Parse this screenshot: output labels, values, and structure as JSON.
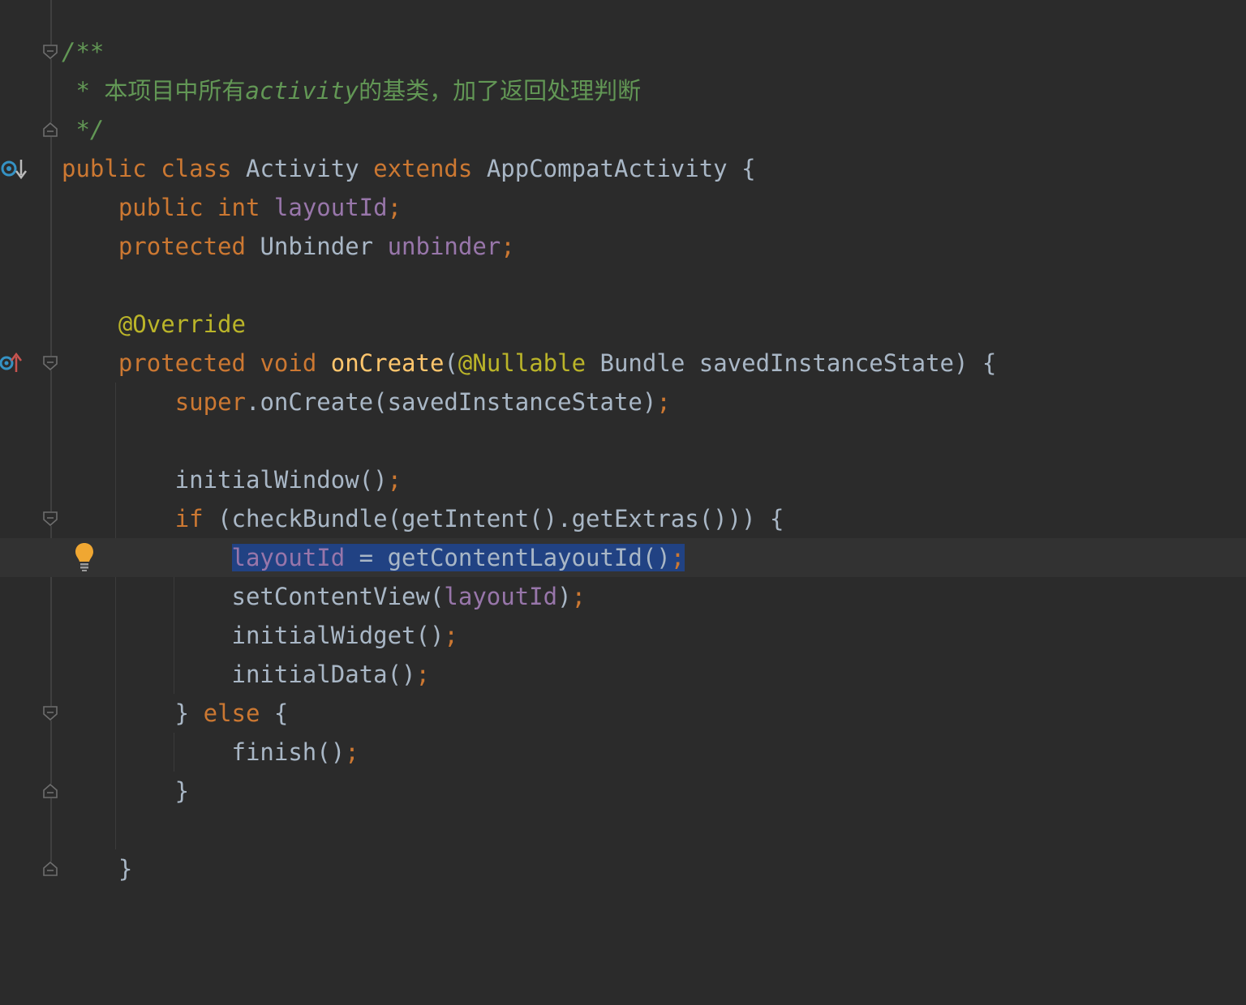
{
  "editor": {
    "lines": [
      {
        "t": "/**",
        "k": "doc"
      },
      {
        "t": " * 本项目中所有activity的基类，加了返回处理判断",
        "k": "doc"
      },
      {
        "t": " */",
        "k": "doc"
      },
      {
        "t": "public class Activity extends AppCompatActivity {",
        "k": "code"
      },
      {
        "t": "    public int layoutId;",
        "k": "code"
      },
      {
        "t": "    protected Unbinder unbinder;",
        "k": "code"
      },
      {
        "t": "",
        "k": "blank"
      },
      {
        "t": "    @Override",
        "k": "code"
      },
      {
        "t": "    protected void onCreate(@Nullable Bundle savedInstanceState) {",
        "k": "code"
      },
      {
        "t": "        super.onCreate(savedInstanceState);",
        "k": "code"
      },
      {
        "t": "",
        "k": "blank"
      },
      {
        "t": "        initialWindow();",
        "k": "code"
      },
      {
        "t": "        if (checkBundle(getIntent().getExtras())) {",
        "k": "code"
      },
      {
        "t": "            layoutId = getContentLayoutId();",
        "k": "code"
      },
      {
        "t": "            setContentView(layoutId);",
        "k": "code"
      },
      {
        "t": "            initialWidget();",
        "k": "code"
      },
      {
        "t": "            initialData();",
        "k": "code"
      },
      {
        "t": "        } else {",
        "k": "code"
      },
      {
        "t": "            finish();",
        "k": "code"
      },
      {
        "t": "        }",
        "k": "code"
      },
      {
        "t": "",
        "k": "blank"
      },
      {
        "t": "    }",
        "k": "code"
      }
    ],
    "selected_text": "layoutId = getContentLayoutId();",
    "current_line": 14
  },
  "gutter": {
    "icons": [
      "implemented-down-icon",
      "override-up-icon",
      "intention-bulb-icon"
    ],
    "fold_markers": [
      1,
      3,
      9,
      13,
      18,
      20,
      22
    ]
  },
  "theme": {
    "background": "#2b2b2b",
    "text": "#a9b7c6",
    "keyword": "#cc7832",
    "field": "#9876aa",
    "method": "#ffc66d",
    "annotation": "#bbb529",
    "doc_comment": "#629755",
    "selection": "#214283",
    "current_line": "#323232"
  }
}
